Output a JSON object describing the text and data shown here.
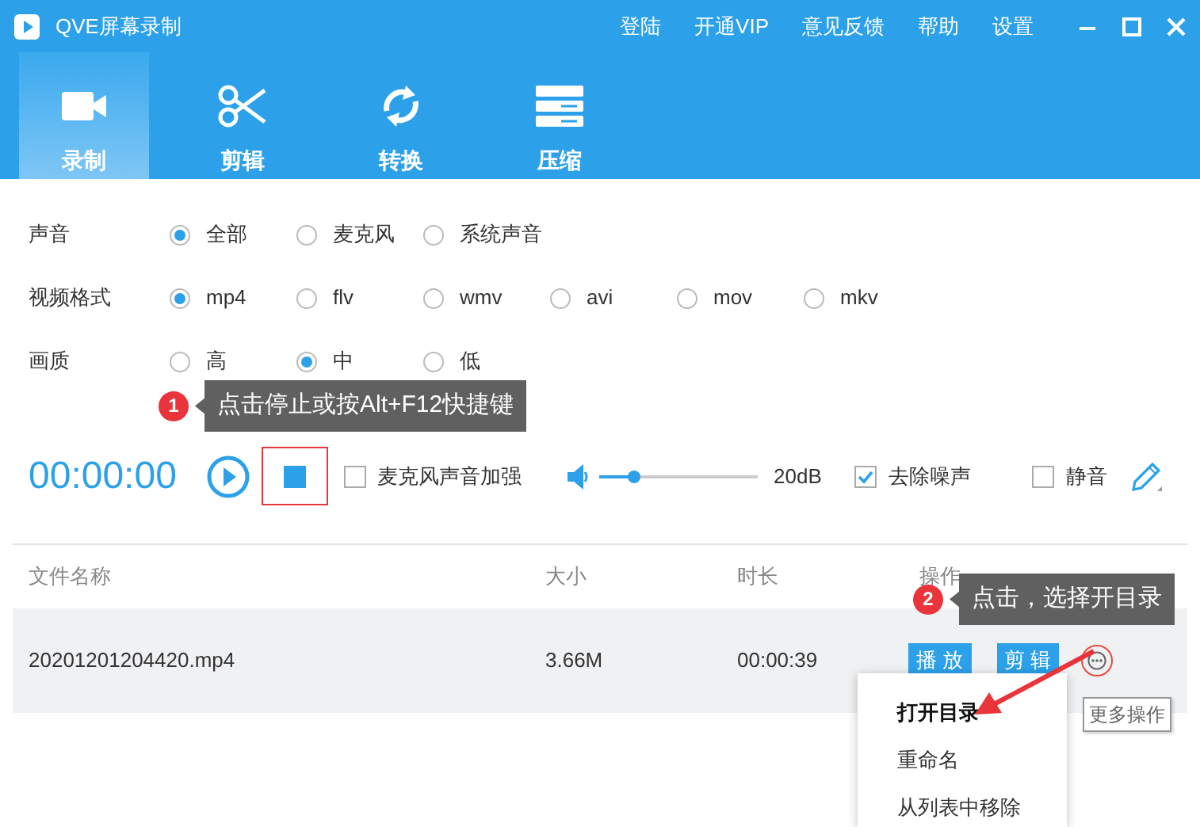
{
  "window": {
    "title": "QVE屏幕录制",
    "links": [
      "登陆",
      "开通VIP",
      "意见反馈",
      "帮助",
      "设置"
    ]
  },
  "tabs": [
    {
      "label": "录制",
      "selected": true
    },
    {
      "label": "剪辑",
      "selected": false
    },
    {
      "label": "转换",
      "selected": false
    },
    {
      "label": "压缩",
      "selected": false
    }
  ],
  "settings": [
    {
      "label": "声音",
      "options": [
        {
          "label": "全部",
          "selected": true
        },
        {
          "label": "麦克风",
          "selected": false
        },
        {
          "label": "系统声音",
          "selected": false
        }
      ]
    },
    {
      "label": "视频格式",
      "options": [
        {
          "label": "mp4",
          "selected": true
        },
        {
          "label": "flv",
          "selected": false
        },
        {
          "label": "wmv",
          "selected": false
        },
        {
          "label": "avi",
          "selected": false
        },
        {
          "label": "mov",
          "selected": false
        },
        {
          "label": "mkv",
          "selected": false
        }
      ]
    },
    {
      "label": "画质",
      "options": [
        {
          "label": "高",
          "selected": false
        },
        {
          "label": "中",
          "selected": true
        },
        {
          "label": "低",
          "selected": false
        }
      ]
    }
  ],
  "recorder": {
    "time": "00:00:00",
    "mic_boost": {
      "label": "麦克风声音加强",
      "checked": false
    },
    "volume": {
      "level": 0.22,
      "reading": "20dB"
    },
    "denoise": {
      "label": "去除噪声",
      "checked": true
    },
    "mute": {
      "label": "静音",
      "checked": false
    }
  },
  "table": {
    "columns": [
      "文件名称",
      "大小",
      "时长",
      "操作"
    ],
    "rows": [
      {
        "name": "20201201204420.mp4",
        "size": "3.66M",
        "duration": "00:00:39",
        "actions": [
          "播 放",
          "剪 辑"
        ]
      }
    ]
  },
  "menu": {
    "items": [
      {
        "label": "打开目录",
        "selected": true
      },
      {
        "label": "重命名",
        "selected": false
      },
      {
        "label": "从列表中移除",
        "selected": false
      }
    ]
  },
  "more_tooltip": "更多操作",
  "hints": [
    {
      "number": "1",
      "text": "点击停止或按Alt+F12快捷键"
    },
    {
      "number": "2",
      "text": "点击，选择开目录"
    }
  ]
}
